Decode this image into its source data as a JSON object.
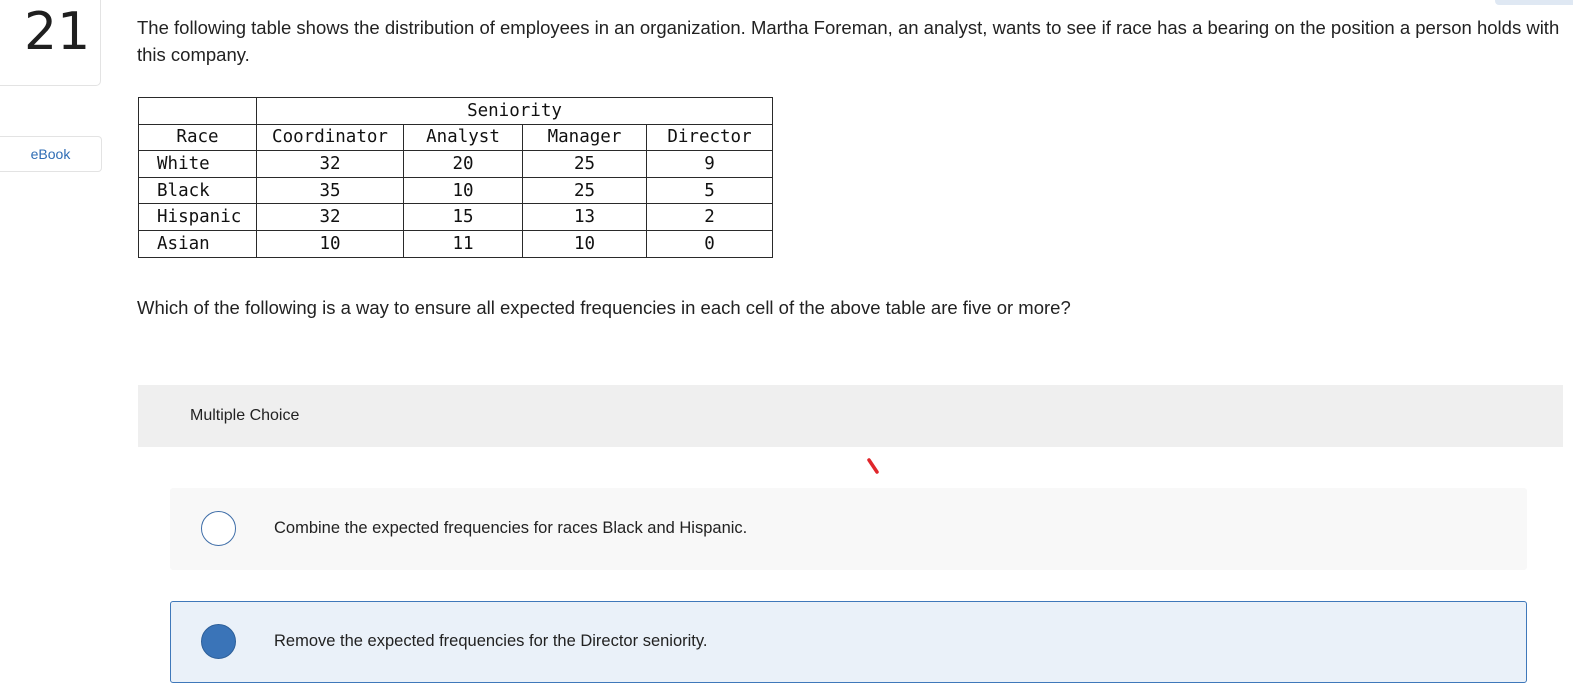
{
  "question_number": "21",
  "ebook_label": "eBook",
  "question_text": "The following table shows the distribution of employees in an organization. Martha Foreman, an analyst, wants to see if race has a bearing on the position a person holds with this company.",
  "table": {
    "group_header": "Seniority",
    "row_header": "Race",
    "columns": [
      "Coordinator",
      "Analyst",
      "Manager",
      "Director"
    ],
    "rows": [
      {
        "label": "White",
        "values": [
          "32",
          "20",
          "25",
          "9"
        ]
      },
      {
        "label": "Black",
        "values": [
          "35",
          "10",
          "25",
          "5"
        ]
      },
      {
        "label": "Hispanic",
        "values": [
          "32",
          "15",
          "13",
          "2"
        ]
      },
      {
        "label": "Asian",
        "values": [
          "10",
          "11",
          "10",
          "0"
        ]
      }
    ]
  },
  "prompt_text": "Which of the following is a way to ensure all expected frequencies in each cell of the above table are five or more?",
  "multiple_choice": {
    "label": "Multiple Choice",
    "options": [
      {
        "text": "Combine the expected frequencies for races Black and Hispanic.",
        "selected": false
      },
      {
        "text": "Remove the expected frequencies for the Director seniority.",
        "selected": true
      }
    ]
  },
  "colors": {
    "accent": "#3a74b8",
    "selected_bg": "#eaf1f9",
    "panel_bg": "#f2f2f2",
    "ebook_link": "#2f6db5",
    "annotation_red": "#e0262b"
  }
}
